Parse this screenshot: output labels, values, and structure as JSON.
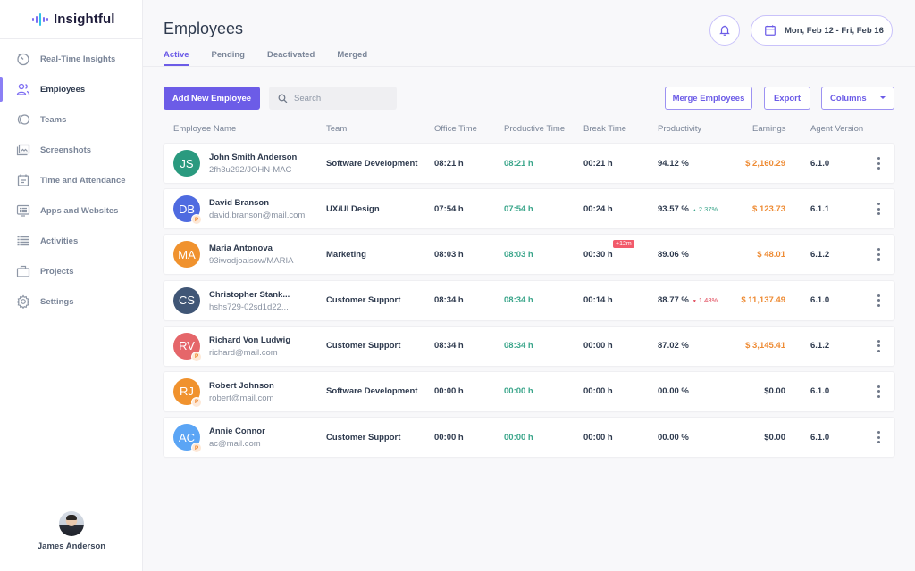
{
  "app": {
    "name": "Insightful"
  },
  "sidebar": {
    "items": [
      {
        "label": "Real-Time Insights",
        "icon": "clock-dashboard-icon",
        "active": false
      },
      {
        "label": "Employees",
        "icon": "users-icon",
        "active": true
      },
      {
        "label": "Teams",
        "icon": "teams-circles-icon",
        "active": false
      },
      {
        "label": "Screenshots",
        "icon": "screenshots-gallery-icon",
        "active": false
      },
      {
        "label": "Time and Attendance",
        "icon": "calendar-icon",
        "active": false
      },
      {
        "label": "Apps and Websites",
        "icon": "monitor-list-icon",
        "active": false
      },
      {
        "label": "Activities",
        "icon": "list-icon",
        "active": false
      },
      {
        "label": "Projects",
        "icon": "briefcase-icon",
        "active": false
      },
      {
        "label": "Settings",
        "icon": "gear-icon",
        "active": false
      }
    ],
    "user": {
      "name": "James Anderson"
    }
  },
  "header": {
    "title": "Employees",
    "tabs": [
      {
        "label": "Active",
        "active": true
      },
      {
        "label": "Pending",
        "active": false
      },
      {
        "label": "Deactivated",
        "active": false
      },
      {
        "label": "Merged",
        "active": false
      }
    ],
    "date_range": "Mon, Feb 12 - Fri,  Feb 16"
  },
  "toolbar": {
    "add_label": "Add New Employee",
    "search_placeholder": "Search",
    "search_value": "",
    "merge_label": "Merge Employees",
    "export_label": "Export",
    "columns_label": "Columns"
  },
  "table": {
    "columns": [
      "Employee Name",
      "Team",
      "Office Time",
      "Productive Time",
      "Break Time",
      "Productivity",
      "Earnings",
      "Agent Version"
    ],
    "rows": [
      {
        "initials": "JS",
        "color": "#2a9a7f",
        "pending": false,
        "name": "John Smith Anderson",
        "sub": "2fh3u292/JOHN-MAC",
        "team": "Software Development",
        "office": "08:21 h",
        "productive": "08:21 h",
        "break": "00:21 h",
        "break_extra": "",
        "productivity": "94.12 %",
        "delta": "",
        "delta_dir": "",
        "earnings": "$ 2,160.29",
        "version": "6.1.0"
      },
      {
        "initials": "DB",
        "color": "#4f6be0",
        "pending": true,
        "name": "David Branson",
        "sub": "david.branson@mail.com",
        "team": "UX/UI Design",
        "office": "07:54 h",
        "productive": "07:54 h",
        "break": "00:24 h",
        "break_extra": "",
        "productivity": "93.57 %",
        "delta": "2.37%",
        "delta_dir": "up",
        "earnings": "$ 123.73",
        "version": "6.1.1"
      },
      {
        "initials": "MA",
        "color": "#f0922e",
        "pending": false,
        "name": "Maria Antonova",
        "sub": "93iwodjoaisow/MARIA",
        "team": "Marketing",
        "office": "08:03 h",
        "productive": "08:03 h",
        "break": "00:30 h",
        "break_extra": "+12m",
        "productivity": "89.06 %",
        "delta": "",
        "delta_dir": "",
        "earnings": "$ 48.01",
        "version": "6.1.2"
      },
      {
        "initials": "CS",
        "color": "#405676",
        "pending": false,
        "name": "Christopher Stank...",
        "sub": "hshs729-02sd1d22...",
        "team": "Customer Support",
        "office": "08:34 h",
        "productive": "08:34 h",
        "break": "00:14 h",
        "break_extra": "",
        "productivity": "88.77 %",
        "delta": "1.48%",
        "delta_dir": "down",
        "earnings": "$ 11,137.49",
        "version": "6.1.0"
      },
      {
        "initials": "RV",
        "color": "#e5666a",
        "pending": true,
        "name": "Richard Von Ludwig",
        "sub": "richard@mail.com",
        "team": "Customer Support",
        "office": "08:34 h",
        "productive": "08:34 h",
        "break": "00:00 h",
        "break_extra": "",
        "productivity": "87.02 %",
        "delta": "",
        "delta_dir": "",
        "earnings": "$ 3,145.41",
        "version": "6.1.2"
      },
      {
        "initials": "RJ",
        "color": "#f0922e",
        "pending": true,
        "name": "Robert Johnson",
        "sub": "robert@mail.com",
        "team": "Software Development",
        "office": "00:00 h",
        "productive": "00:00 h",
        "break": "00:00 h",
        "break_extra": "",
        "productivity": "00.00 %",
        "delta": "",
        "delta_dir": "",
        "earnings": "$0.00",
        "version": "6.1.0"
      },
      {
        "initials": "AC",
        "color": "#5ba5f5",
        "pending": true,
        "name": "Annie Connor",
        "sub": "ac@mail.com",
        "team": "Customer Support",
        "office": "00:00 h",
        "productive": "00:00 h",
        "break": "00:00 h",
        "break_extra": "",
        "productivity": "00.00 %",
        "delta": "",
        "delta_dir": "",
        "earnings": "$0.00",
        "version": "6.1.0"
      }
    ]
  },
  "colors": {
    "accent": "#6c5ce7",
    "productive": "#3aa58a",
    "earnings": "#ee8b34",
    "negative": "#e14a5b"
  }
}
